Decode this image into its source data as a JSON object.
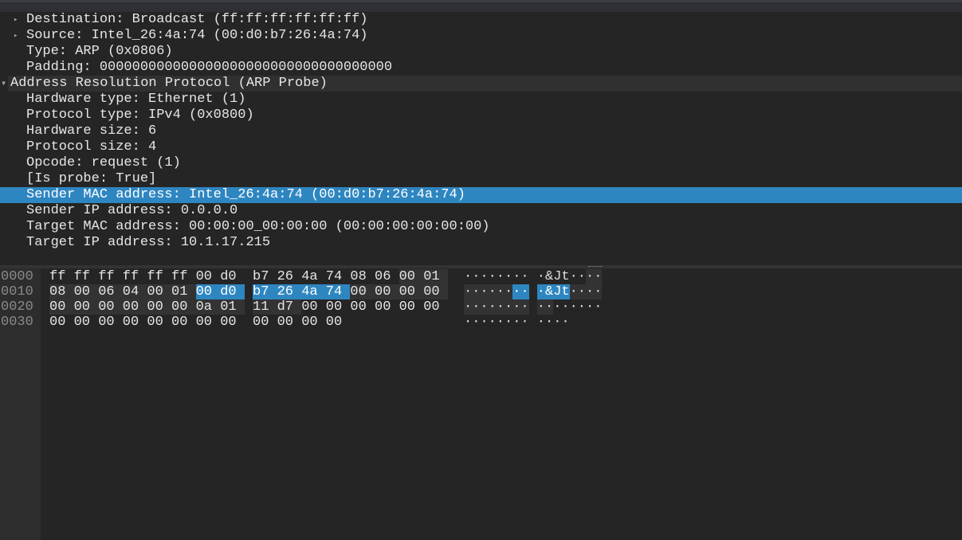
{
  "tree": [
    {
      "text": "Destination: Broadcast (ff:ff:ff:ff:ff:ff)",
      "indent": 1,
      "arrow": "collapsed"
    },
    {
      "text": "Source: Intel_26:4a:74 (00:d0:b7:26:4a:74)",
      "indent": 1,
      "arrow": "collapsed"
    },
    {
      "text": "Type: ARP (0x0806)",
      "indent": 1
    },
    {
      "text": "Padding: 000000000000000000000000000000000000",
      "indent": 1
    },
    {
      "text": "Address Resolution Protocol (ARP Probe)",
      "indent": 0,
      "arrow": "expanded",
      "header": true
    },
    {
      "text": "Hardware type: Ethernet (1)",
      "indent": 1
    },
    {
      "text": "Protocol type: IPv4 (0x0800)",
      "indent": 1
    },
    {
      "text": "Hardware size: 6",
      "indent": 1
    },
    {
      "text": "Protocol size: 4",
      "indent": 1
    },
    {
      "text": "Opcode: request (1)",
      "indent": 1
    },
    {
      "text": "[Is probe: True]",
      "indent": 1
    },
    {
      "text": "Sender MAC address: Intel_26:4a:74 (00:d0:b7:26:4a:74)",
      "indent": 1,
      "selected": true
    },
    {
      "text": "Sender IP address: 0.0.0.0",
      "indent": 1
    },
    {
      "text": "Target MAC address: 00:00:00_00:00:00 (00:00:00:00:00:00)",
      "indent": 1
    },
    {
      "text": "Target IP address: 10.1.17.215",
      "indent": 1
    }
  ],
  "hex": {
    "protocol_range": [
      14,
      41
    ],
    "selected_range": [
      22,
      27
    ],
    "rows": [
      {
        "offset": "0000",
        "bytes": [
          "ff",
          "ff",
          "ff",
          "ff",
          "ff",
          "ff",
          "00",
          "d0",
          "b7",
          "26",
          "4a",
          "74",
          "08",
          "06",
          "00",
          "01"
        ],
        "ascii": [
          "·",
          "·",
          "·",
          "·",
          "·",
          "·",
          "·",
          "·",
          "·",
          "&",
          "J",
          "t",
          "·",
          "·",
          "·",
          "·"
        ]
      },
      {
        "offset": "0010",
        "bytes": [
          "08",
          "00",
          "06",
          "04",
          "00",
          "01",
          "00",
          "d0",
          "b7",
          "26",
          "4a",
          "74",
          "00",
          "00",
          "00",
          "00"
        ],
        "ascii": [
          "·",
          "·",
          "·",
          "·",
          "·",
          "·",
          "·",
          "·",
          "·",
          "&",
          "J",
          "t",
          "·",
          "·",
          "·",
          "·"
        ]
      },
      {
        "offset": "0020",
        "bytes": [
          "00",
          "00",
          "00",
          "00",
          "00",
          "00",
          "0a",
          "01",
          "11",
          "d7",
          "00",
          "00",
          "00",
          "00",
          "00",
          "00"
        ],
        "ascii": [
          "·",
          "·",
          "·",
          "·",
          "·",
          "·",
          "·",
          "·",
          "·",
          "·",
          "·",
          "·",
          "·",
          "·",
          "·",
          "·"
        ]
      },
      {
        "offset": "0030",
        "bytes": [
          "00",
          "00",
          "00",
          "00",
          "00",
          "00",
          "00",
          "00",
          "00",
          "00",
          "00",
          "00"
        ],
        "ascii": [
          "·",
          "·",
          "·",
          "·",
          "·",
          "·",
          "·",
          "·",
          "·",
          "·",
          "·",
          "·"
        ]
      }
    ]
  },
  "colors": {
    "selection": "#2e86c1",
    "background": "#252525"
  }
}
